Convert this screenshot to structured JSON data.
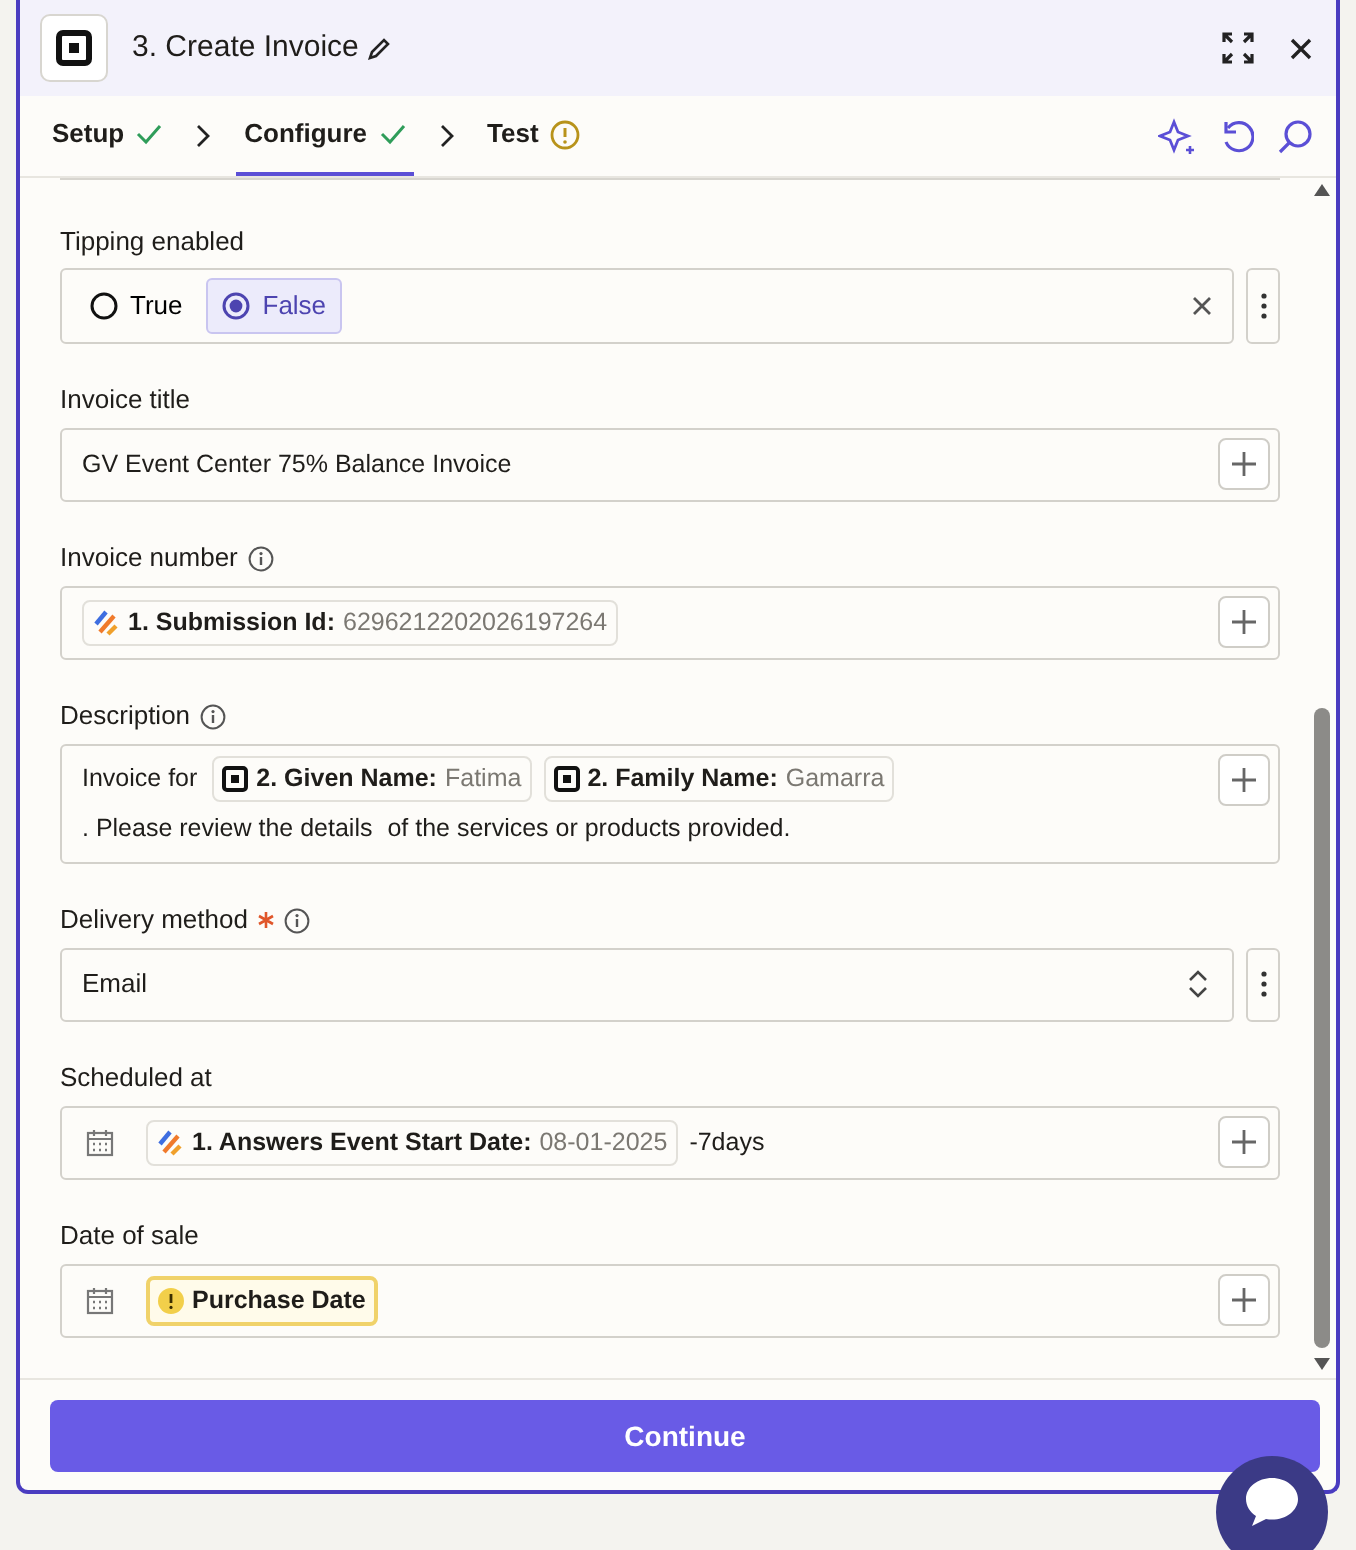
{
  "header": {
    "title": "3. Create Invoice"
  },
  "steps": [
    {
      "label": "Setup",
      "kind": "done",
      "selected": false
    },
    {
      "label": "Configure",
      "kind": "done",
      "selected": true
    },
    {
      "label": "Test",
      "kind": "warning",
      "selected": false
    }
  ],
  "fields": [
    {
      "kind": "radio",
      "label": "Tipping enabled",
      "options": [
        {
          "label": "True",
          "selected": false
        },
        {
          "label": "False",
          "selected": true
        }
      ]
    },
    {
      "kind": "text",
      "label": "Invoice title",
      "parts": [
        {
          "kind": "text",
          "text": "GV Event Center 75% Balance Invoice"
        }
      ]
    },
    {
      "kind": "text",
      "label": "Invoice number",
      "info": true,
      "parts": [
        {
          "kind": "form",
          "name": "1. Submission Id:",
          "value": "6296212202026197264"
        }
      ]
    },
    {
      "kind": "text",
      "label": "Description",
      "info": true,
      "parts": [
        {
          "kind": "text",
          "text": "Invoice for"
        },
        {
          "kind": "square",
          "name": "2. Given Name:",
          "value": "Fatima"
        },
        {
          "kind": "square",
          "name": "2. Family Name:",
          "value": "Gamarra"
        },
        {
          "kind": "text",
          "text": ". Please review the details"
        },
        {
          "kind": "text",
          "text": "of the services or products provided."
        }
      ]
    },
    {
      "kind": "select",
      "label": "Delivery method",
      "required": true,
      "info": true,
      "value": "Email"
    },
    {
      "kind": "date",
      "label": "Scheduled at",
      "parts": [
        {
          "kind": "form",
          "name": "1. Answers Event Start Date:",
          "value": "08-01-2025"
        },
        {
          "kind": "text",
          "text": "-7days"
        }
      ]
    },
    {
      "kind": "date",
      "label": "Date of sale",
      "parts": [
        {
          "kind": "warning",
          "name": "Purchase Date"
        }
      ]
    }
  ],
  "footer": {
    "button": "Continue"
  }
}
